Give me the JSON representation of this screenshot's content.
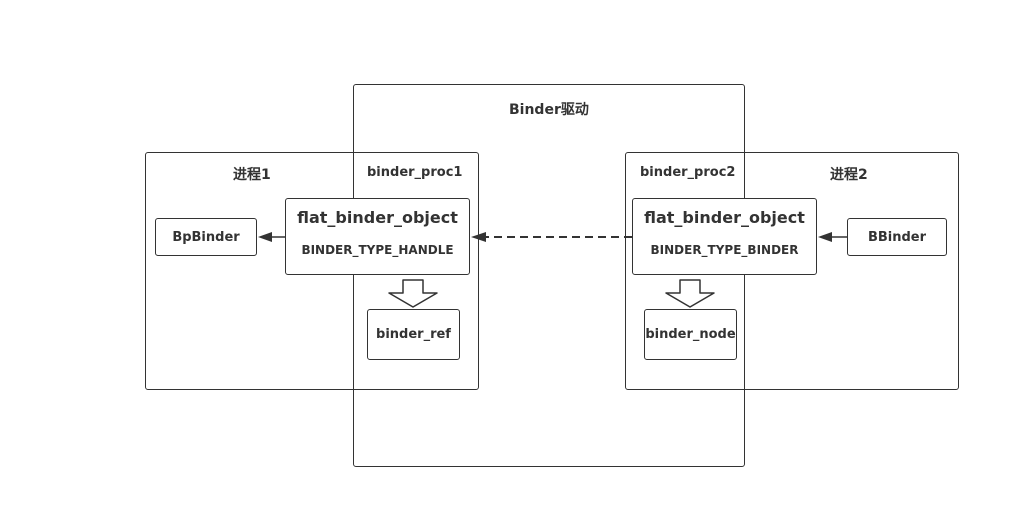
{
  "driver": {
    "title": "Binder驱动"
  },
  "process1": {
    "title": "进程1",
    "proc_label": "binder_proc1",
    "bpbinder": "BpBinder",
    "fbo_title": "flat_binder_object",
    "fbo_type": "BINDER_TYPE_HANDLE",
    "ref": "binder_ref"
  },
  "process2": {
    "title": "进程2",
    "proc_label": "binder_proc2",
    "bbinder": "BBinder",
    "fbo_title": "flat_binder_object",
    "fbo_type": "BINDER_TYPE_BINDER",
    "node": "binder_node"
  },
  "colors": {
    "stroke": "#333333",
    "background": "#ffffff"
  }
}
